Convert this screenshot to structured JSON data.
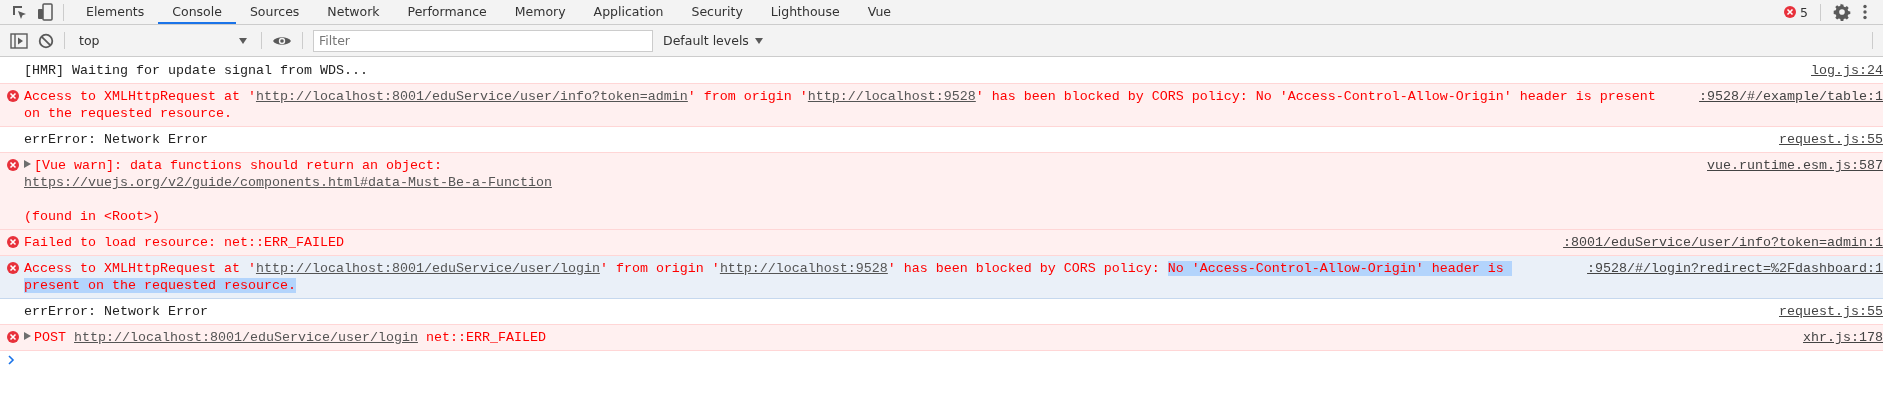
{
  "tabs": [
    {
      "label": "Elements",
      "selected": false
    },
    {
      "label": "Console",
      "selected": true
    },
    {
      "label": "Sources",
      "selected": false
    },
    {
      "label": "Network",
      "selected": false
    },
    {
      "label": "Performance",
      "selected": false
    },
    {
      "label": "Memory",
      "selected": false
    },
    {
      "label": "Application",
      "selected": false
    },
    {
      "label": "Security",
      "selected": false
    },
    {
      "label": "Lighthouse",
      "selected": false
    },
    {
      "label": "Vue",
      "selected": false
    }
  ],
  "error_count": "5",
  "toolbar": {
    "context": "top",
    "filter": {
      "placeholder": "Filter"
    },
    "levels": "Default levels"
  },
  "messages": [
    {
      "kind": "log",
      "focused": false,
      "expandable": false,
      "parts": [
        {
          "kind": "text",
          "text": "[HMR] Waiting for update signal from WDS..."
        }
      ],
      "source": "log.js:24"
    },
    {
      "kind": "error",
      "focused": false,
      "expandable": false,
      "parts": [
        {
          "kind": "text",
          "text": "Access to XMLHttpRequest at '"
        },
        {
          "kind": "link",
          "text": "http://localhost:8001/eduService/user/info?token=admin"
        },
        {
          "kind": "text",
          "text": "' from origin '"
        },
        {
          "kind": "link",
          "text": "http://localhost:9528"
        },
        {
          "kind": "text",
          "text": "' has been blocked by CORS policy: No 'Access-Control-Allow-Origin' header is present on the requested resource."
        }
      ],
      "source": ":9528/#/example/table:1"
    },
    {
      "kind": "log",
      "focused": false,
      "expandable": false,
      "parts": [
        {
          "kind": "text",
          "text": "errError: Network Error"
        }
      ],
      "source": "request.js:55"
    },
    {
      "kind": "error",
      "focused": false,
      "expandable": true,
      "parts": [
        {
          "kind": "text",
          "text": "[Vue warn]: data functions should return an object:\n"
        },
        {
          "kind": "link",
          "text": "https://vuejs.org/v2/guide/components.html#data-Must-Be-a-Function"
        },
        {
          "kind": "text",
          "text": "\n\n(found in <Root>)"
        }
      ],
      "source": "vue.runtime.esm.js:587"
    },
    {
      "kind": "error",
      "focused": false,
      "expandable": false,
      "parts": [
        {
          "kind": "text",
          "text": "Failed to load resource: net::ERR_FAILED"
        }
      ],
      "source": ":8001/eduService/user/info?token=admin:1"
    },
    {
      "kind": "error",
      "focused": true,
      "expandable": false,
      "parts": [
        {
          "kind": "text",
          "text": "Access to XMLHttpRequest at '"
        },
        {
          "kind": "link",
          "text": "http://localhost:8001/eduService/user/login"
        },
        {
          "kind": "text",
          "text": "' from origin '"
        },
        {
          "kind": "link",
          "text": "http://localhost:9528"
        },
        {
          "kind": "text",
          "text": "' has been blocked by CORS policy: "
        },
        {
          "kind": "selection",
          "text": "No 'Access-Control-Allow-Origin' header is present on the requested resource."
        }
      ],
      "source": ":9528/#/login?redirect=%2Fdashboard:1"
    },
    {
      "kind": "log",
      "focused": false,
      "expandable": false,
      "parts": [
        {
          "kind": "text",
          "text": "errError: Network Error"
        }
      ],
      "source": "request.js:55"
    },
    {
      "kind": "error",
      "focused": false,
      "expandable": true,
      "parts": [
        {
          "kind": "text",
          "text": "POST "
        },
        {
          "kind": "link",
          "text": "http://localhost:8001/eduService/user/login"
        },
        {
          "kind": "text",
          "text": " net::ERR_FAILED"
        }
      ],
      "source": "xhr.js:178"
    }
  ]
}
